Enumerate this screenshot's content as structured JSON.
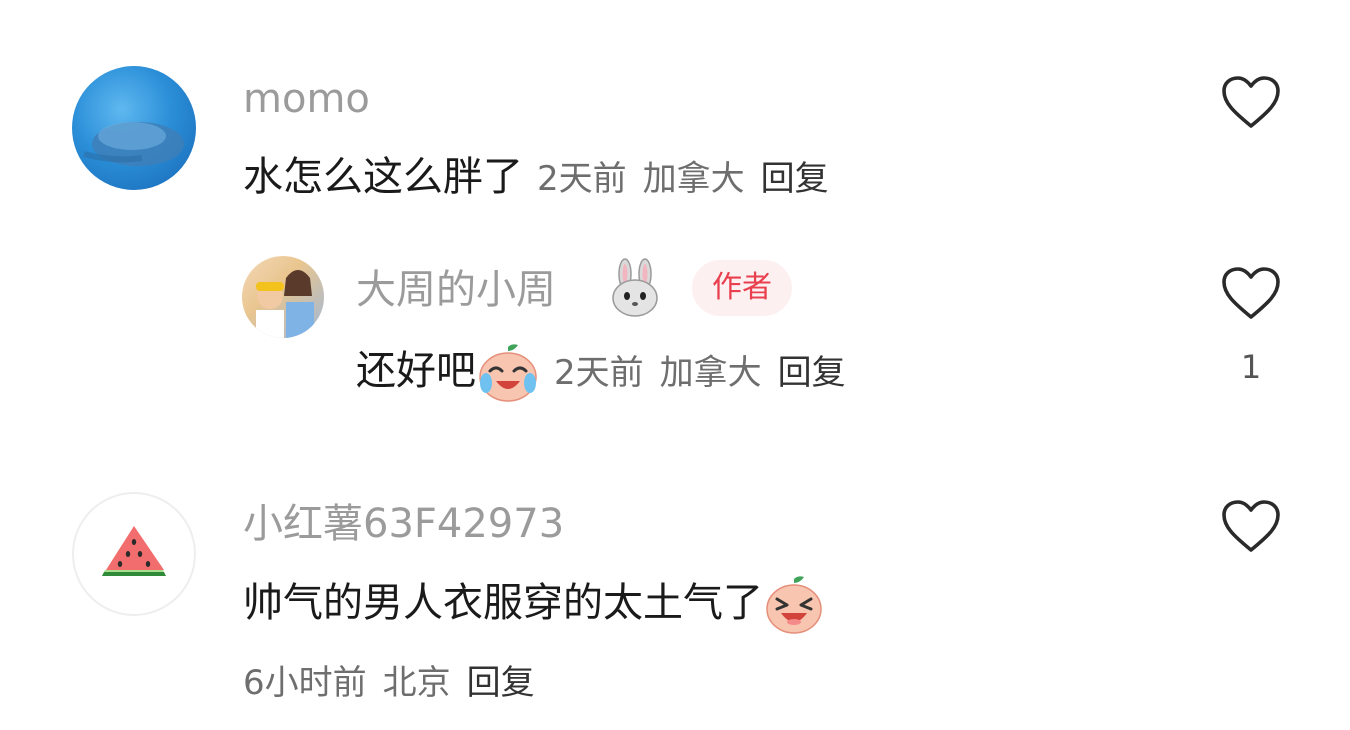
{
  "comments": [
    {
      "username": "momo",
      "avatar": "whale-underwater-avatar",
      "text": "水怎么这么胖了",
      "time": "2天前",
      "location": "加拿大",
      "reply_label": "回复",
      "likes": ""
    },
    {
      "username": "大周的小周",
      "avatar": "couple-photo-avatar",
      "username_emoji": "bunny-face-icon",
      "badge": "作者",
      "text": "还好吧",
      "text_emoji": "crying-laughing-peach-icon",
      "time": "2天前",
      "location": "加拿大",
      "reply_label": "回复",
      "likes": "1"
    },
    {
      "username": "小红薯63F42973",
      "avatar": "watermelon-slice-avatar",
      "text": "帅气的男人衣服穿的太土气了",
      "text_emoji": "laughing-peach-icon",
      "time": "6小时前",
      "location": "北京",
      "reply_label": "回复",
      "likes": ""
    }
  ],
  "colors": {
    "username": "#9b9b9b",
    "meta": "#6e6e6e",
    "badge_bg": "#fdf0f1",
    "badge_text": "#e8404e",
    "heart_stroke": "#2a2a2a"
  }
}
